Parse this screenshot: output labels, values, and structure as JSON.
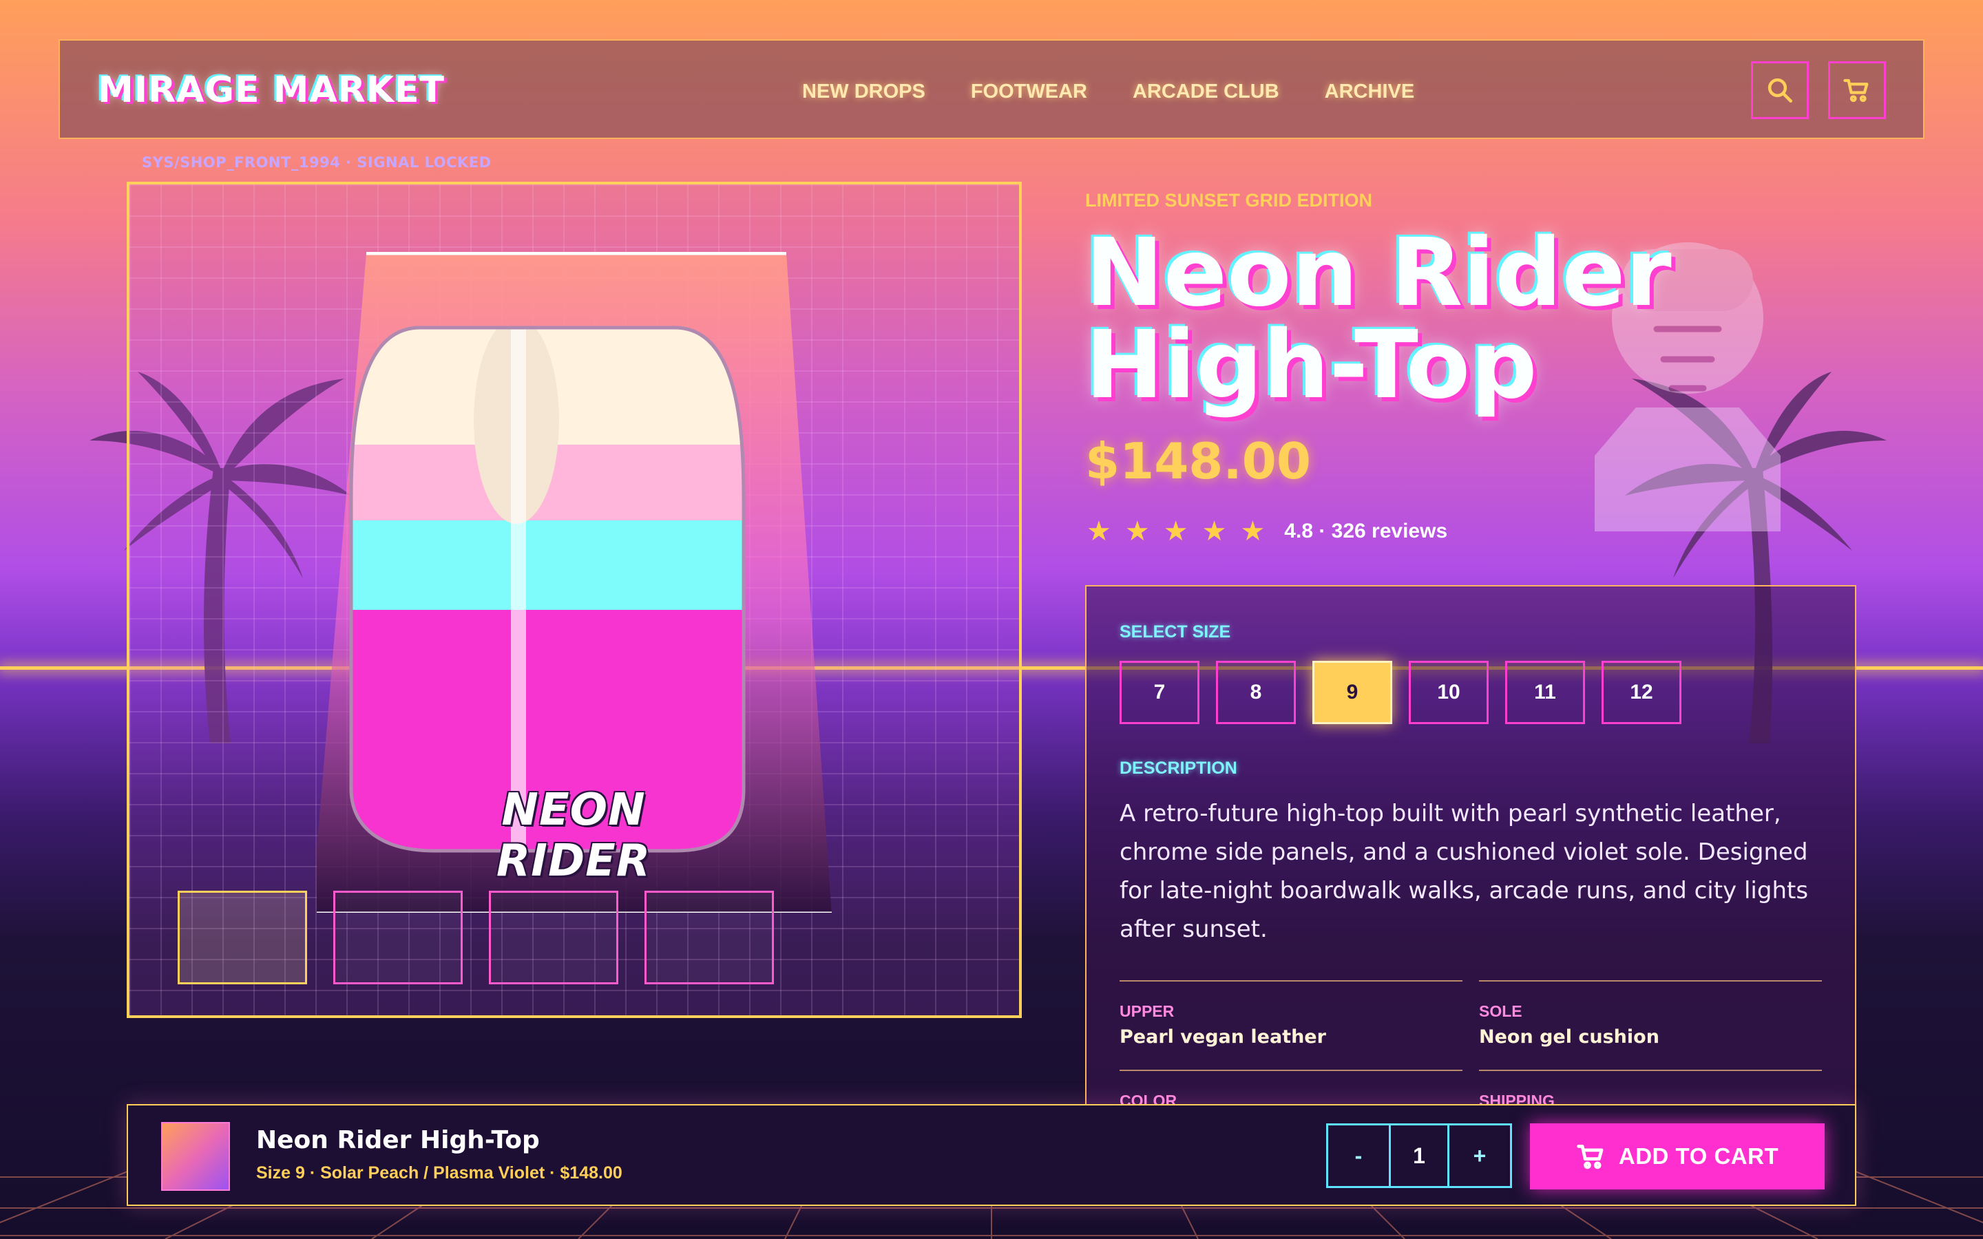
{
  "header": {
    "logo": "MIRAGE MARKET",
    "nav": [
      "NEW DROPS",
      "FOOTWEAR",
      "ARCADE CLUB",
      "ARCHIVE"
    ],
    "icons": [
      "search-icon",
      "cart-icon"
    ]
  },
  "breadcrumb": "SYS/SHOP_FRONT_1994 · SIGNAL LOCKED",
  "product": {
    "edition": "LIMITED SUNSET GRID EDITION",
    "title_line1": "Neon Rider",
    "title_line2": "High-Top",
    "price": "$148.00",
    "rating": 4.8,
    "stars": 5,
    "reviews_text": "4.8 · 326 reviews",
    "shoe_label": "NEON RIDER",
    "thumbnails_count": 4,
    "active_thumbnail": 1
  },
  "size": {
    "label": "SELECT SIZE",
    "options": [
      "7",
      "8",
      "9",
      "10",
      "11",
      "12"
    ],
    "selected": "9"
  },
  "description": {
    "label": "DESCRIPTION",
    "text": "A retro-future high-top built with pearl synthetic leather, chrome side panels, and a cushioned violet sole. Designed for late-night boardwalk walks, arcade runs, and city lights after sunset."
  },
  "specs": [
    {
      "key": "UPPER",
      "value": "Pearl vegan leather"
    },
    {
      "key": "SOLE",
      "value": "Neon gel cushion"
    },
    {
      "key": "COLOR",
      "value": ""
    },
    {
      "key": "SHIPPING",
      "value": ""
    }
  ],
  "cart_bar": {
    "name": "Neon Rider High-Top",
    "subtitle": "Size 9 · Solar Peach / Plasma Violet · $148.00",
    "qty_minus": "-",
    "qty_value": "1",
    "qty_plus": "+",
    "add_label": "ADD TO CART"
  },
  "colors": {
    "accent_pink": "#ff2fcf",
    "accent_gold": "#ffcf5a",
    "accent_cyan": "#63f2ff",
    "shoe_cream": "#fff3df",
    "shoe_pink": "#ffb6da",
    "shoe_cyan": "#7efcfb",
    "shoe_magenta": "#f733d0"
  }
}
